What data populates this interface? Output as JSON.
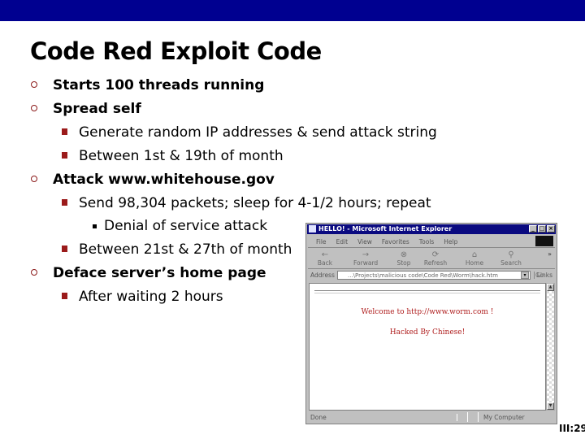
{
  "slide": {
    "title": "Code Red Exploit Code",
    "page_number": "III:29",
    "colors": {
      "top_bar": "#000090",
      "bullet_accent": "#9B1B1B"
    }
  },
  "bullets": [
    {
      "level": 1,
      "text": "Starts 100 threads running"
    },
    {
      "level": 1,
      "text": "Spread self"
    },
    {
      "level": 2,
      "text": "Generate random IP addresses & send attack string"
    },
    {
      "level": 2,
      "text": "Between 1st & 19th of month"
    },
    {
      "level": 1,
      "text": "Attack www.whitehouse.gov"
    },
    {
      "level": 2,
      "text": "Send 98,304 packets; sleep for 4-1/2 hours; repeat"
    },
    {
      "level": 3,
      "text": "Denial of service attack"
    },
    {
      "level": 2,
      "text": "Between 21st & 27th of month"
    },
    {
      "level": 1,
      "text": "Deface server’s home page"
    },
    {
      "level": 2,
      "text": "After waiting 2 hours"
    }
  ],
  "browser": {
    "window_title": "HELLO! - Microsoft Internet Explorer",
    "menu": [
      "File",
      "Edit",
      "View",
      "Favorites",
      "Tools",
      "Help"
    ],
    "toolbar": [
      {
        "label": "Back",
        "icon": "back-arrow-icon",
        "glyph": "←"
      },
      {
        "label": "Forward",
        "icon": "forward-arrow-icon",
        "glyph": "→"
      },
      {
        "label": "Stop",
        "icon": "stop-icon",
        "glyph": "⊗"
      },
      {
        "label": "Refresh",
        "icon": "refresh-icon",
        "glyph": "⟳"
      },
      {
        "label": "Home",
        "icon": "home-icon",
        "glyph": "⌂"
      },
      {
        "label": "Search",
        "icon": "search-icon",
        "glyph": "⚲"
      }
    ],
    "address_label": "Address",
    "address_value": "...\\Projects\\malicious code\\Code Red\\Worm\\hack.htm",
    "go_label": "Go",
    "links_label": "Links",
    "page": {
      "line1": "Welcome to http://www.worm.com !",
      "line2": "Hacked By Chinese!"
    },
    "status": {
      "left": "Done",
      "zone": "My Computer"
    }
  }
}
